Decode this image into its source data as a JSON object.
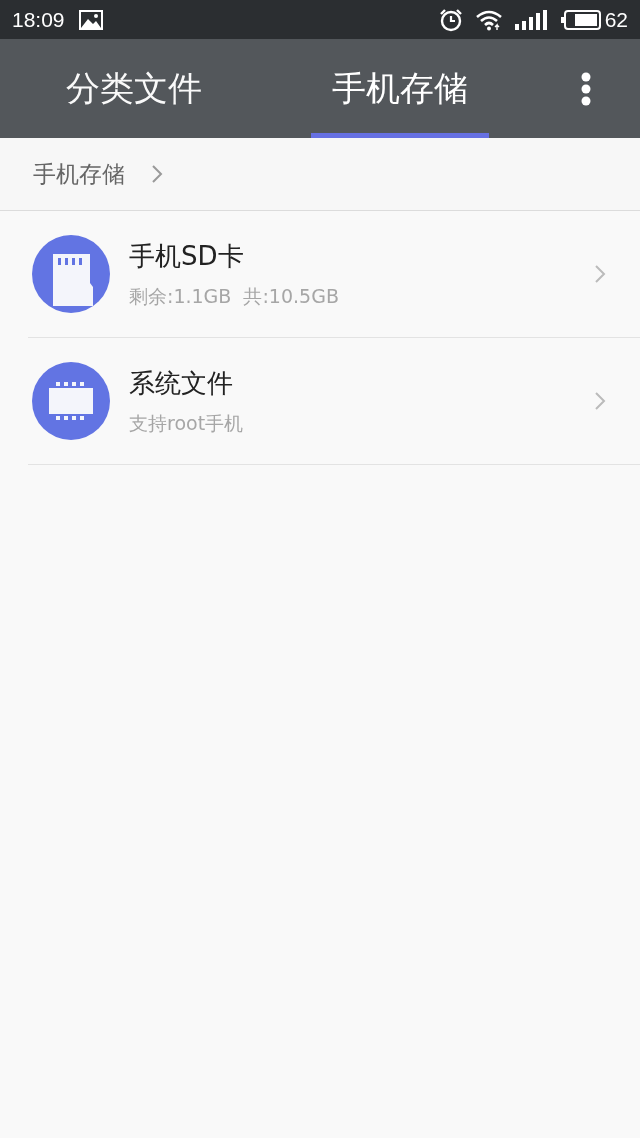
{
  "status_bar": {
    "time": "18:09",
    "battery_text": "62"
  },
  "tabs": [
    {
      "label": "分类文件",
      "selected": false
    },
    {
      "label": "手机存储",
      "selected": true
    }
  ],
  "breadcrumb": [
    "手机存储"
  ],
  "items": [
    {
      "kind": "sd",
      "title": "手机SD卡",
      "subtitle": "剩余:1.1GB  共:10.5GB"
    },
    {
      "kind": "chip",
      "title": "系统文件",
      "subtitle": "支持root手机"
    }
  ]
}
